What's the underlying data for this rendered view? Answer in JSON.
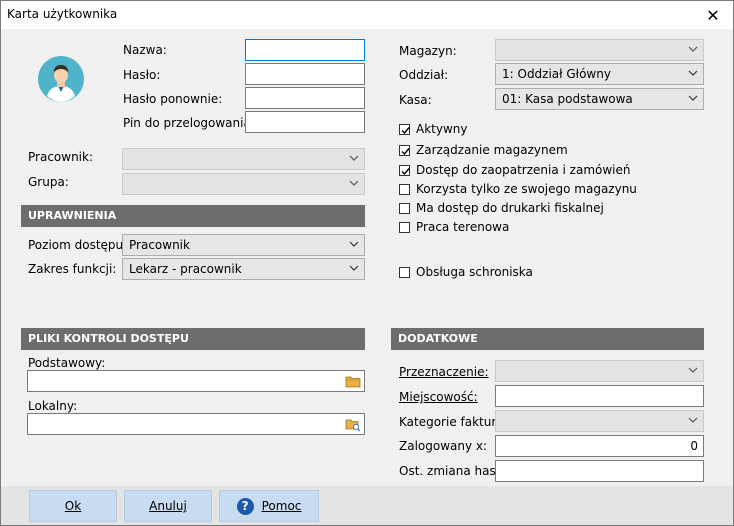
{
  "window": {
    "title": "Karta użytkownika",
    "close_glyph": "✕"
  },
  "avatar": {
    "icon": "user-avatar-icon"
  },
  "login": {
    "nazwa_label": "Nazwa:",
    "haslo_label": "Hasło:",
    "haslo2_label": "Hasło ponownie:",
    "pin_label": "Pin do przelogowania:",
    "nazwa_value": "",
    "haslo_value": "",
    "haslo2_value": "",
    "pin_value": ""
  },
  "right_top": {
    "magazyn_label": "Magazyn:",
    "magazyn_value": "",
    "oddzial_label": "Oddział:",
    "oddzial_value": "1: Oddział Główny",
    "kasa_label": "Kasa:",
    "kasa_value": "01: Kasa podstawowa"
  },
  "employee": {
    "pracownik_label": "Pracownik:",
    "pracownik_value": "",
    "grupa_label": "Grupa:",
    "grupa_value": ""
  },
  "permissions": {
    "header": "UPRAWNIENIA",
    "poziom_label": "Poziom dostępu:",
    "poziom_value": "Pracownik",
    "zakres_label": "Zakres funkcji:",
    "zakres_value": "Lekarz - pracownik"
  },
  "checkboxes": [
    {
      "label": "Aktywny",
      "checked": true
    },
    {
      "label": "Zarządzanie magazynem",
      "checked": true
    },
    {
      "label": "Dostęp do zaopatrzenia i zamówień",
      "checked": true
    },
    {
      "label": "Korzysta tylko ze swojego magazynu",
      "checked": false
    },
    {
      "label": "Ma dostęp do drukarki fiskalnej",
      "checked": false
    },
    {
      "label": "Praca terenowa",
      "checked": false
    },
    {
      "label": "Obsługa schroniska",
      "checked": false
    }
  ],
  "access_files": {
    "header": "PLIKI KONTROLI DOSTĘPU",
    "podstawowy_label": "Podstawowy:",
    "podstawowy_value": "",
    "lokalny_label": "Lokalny:",
    "lokalny_value": ""
  },
  "extra": {
    "header": "DODATKOWE",
    "przeznaczenie_label": "Przeznaczenie:",
    "przeznaczenie_value": "",
    "miejscowosc_label": "Miejscowość:",
    "miejscowosc_value": "",
    "kategorie_label": "Kategorie faktur:",
    "kategorie_value": "",
    "zalogowany_label": "Zalogowany x:",
    "zalogowany_value": "0",
    "zmiana_label": "Ost. zmiana hasła:",
    "zmiana_value": ""
  },
  "buttons": {
    "ok": "Ok",
    "anuluj": "Anuluj",
    "pomoc": "Pomoc",
    "help_glyph": "?"
  },
  "colors": {
    "section_bg": "#6d6d6d",
    "button_bg": "#c7dcf0",
    "focus_border": "#0078d7",
    "help_icon": "#1e5aa8"
  }
}
